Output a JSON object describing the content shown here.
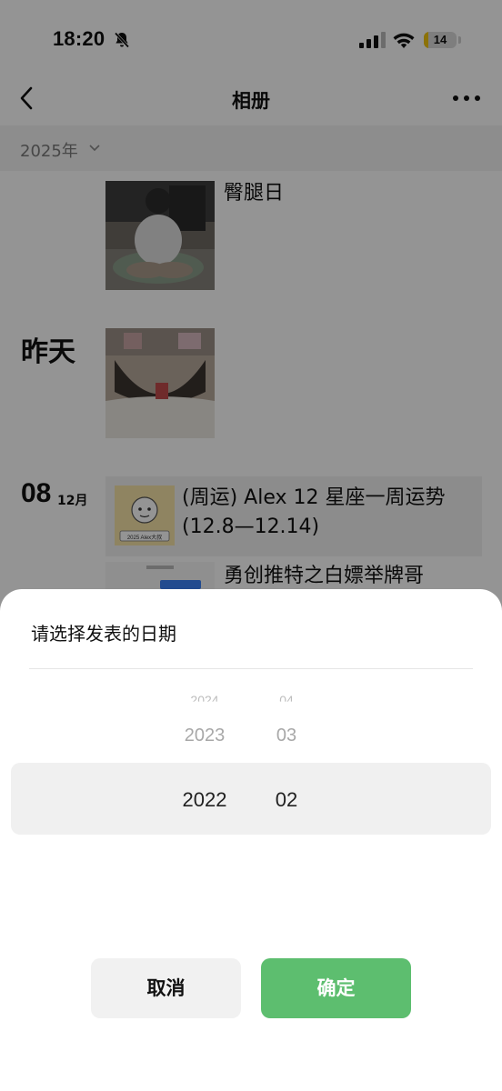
{
  "status": {
    "time": "18:20",
    "battery": "14",
    "battery_level": 0.14
  },
  "nav": {
    "title": "相册",
    "back_icon": "chevron-left-icon",
    "more_icon": "more-dots-icon"
  },
  "filter": {
    "year": "2025年"
  },
  "feed": {
    "post1": {
      "caption": "臀腿日"
    },
    "post2": {
      "day": "昨天"
    },
    "post3": {
      "day": "08",
      "month": "12月",
      "link_title": "(周运) Alex 12 星座一周运势 (12.8—12.14)",
      "thumb_text": "2025 Alex大叔"
    },
    "post4": {
      "caption": "勇创推特之白嫖举牌哥"
    }
  },
  "sheet": {
    "title": "请选择发表的日期",
    "years": [
      "2024",
      "2023",
      "2022"
    ],
    "months": [
      "04",
      "03",
      "02"
    ],
    "cancel": "取消",
    "confirm": "确定"
  },
  "colors": {
    "confirm_green": "#5dbe6f",
    "battery_yellow": "#f1c40f"
  }
}
